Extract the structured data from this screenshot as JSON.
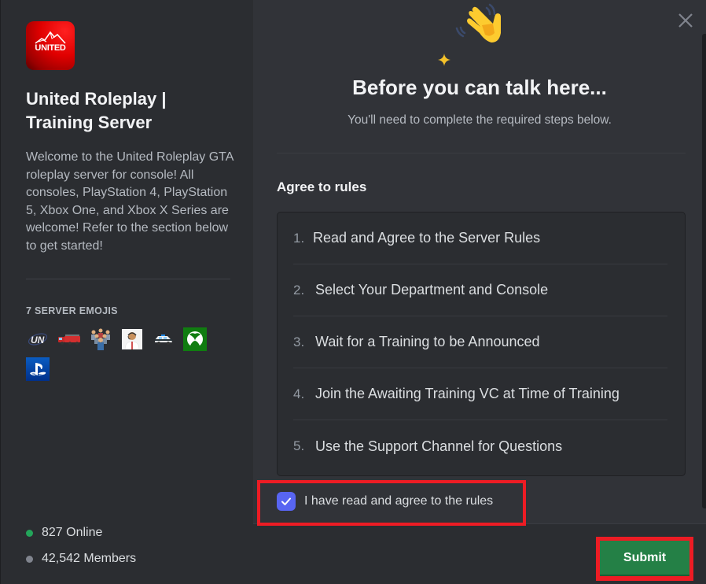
{
  "server": {
    "icon_text": "UNITED",
    "name": "United Roleplay | Training Server",
    "description": "Welcome to the United Roleplay GTA roleplay server for console! All consoles, PlayStation 4, PlayStation 5, Xbox One, and Xbox X Series are welcome! Refer to the section below to get started!",
    "emoji_heading": "7 SERVER EMOJIS",
    "emojis": [
      {
        "name": "un-logo-emoji"
      },
      {
        "name": "fire-truck-emoji"
      },
      {
        "name": "group-emoji"
      },
      {
        "name": "support-agent-emoji"
      },
      {
        "name": "police-car-emoji"
      },
      {
        "name": "xbox-emoji"
      },
      {
        "name": "playstation-emoji"
      }
    ],
    "online": "827 Online",
    "members": "42,542 Members",
    "online_color": "#23a55a",
    "members_color": "#80848e"
  },
  "modal": {
    "title": "Before you can talk here...",
    "subtitle": "You'll need to complete the required steps below.",
    "section_title": "Agree to rules",
    "rules": [
      {
        "num": "1.",
        "text": "Read and Agree to the Server Rules"
      },
      {
        "num": "2.",
        "text": "Select Your Department and Console"
      },
      {
        "num": "3.",
        "text": "Wait for a Training to be Announced"
      },
      {
        "num": "4.",
        "text": "Join the Awaiting Training VC at Time of Training"
      },
      {
        "num": "5.",
        "text": "Use the Support Channel for Questions"
      }
    ],
    "agree_label": "I have read and agree to the rules",
    "agree_checked": true,
    "submit_label": "Submit",
    "close_icon": "close-icon",
    "accent_color": "#5865f2",
    "submit_color": "#248046",
    "highlight_color": "#ed1c24"
  }
}
